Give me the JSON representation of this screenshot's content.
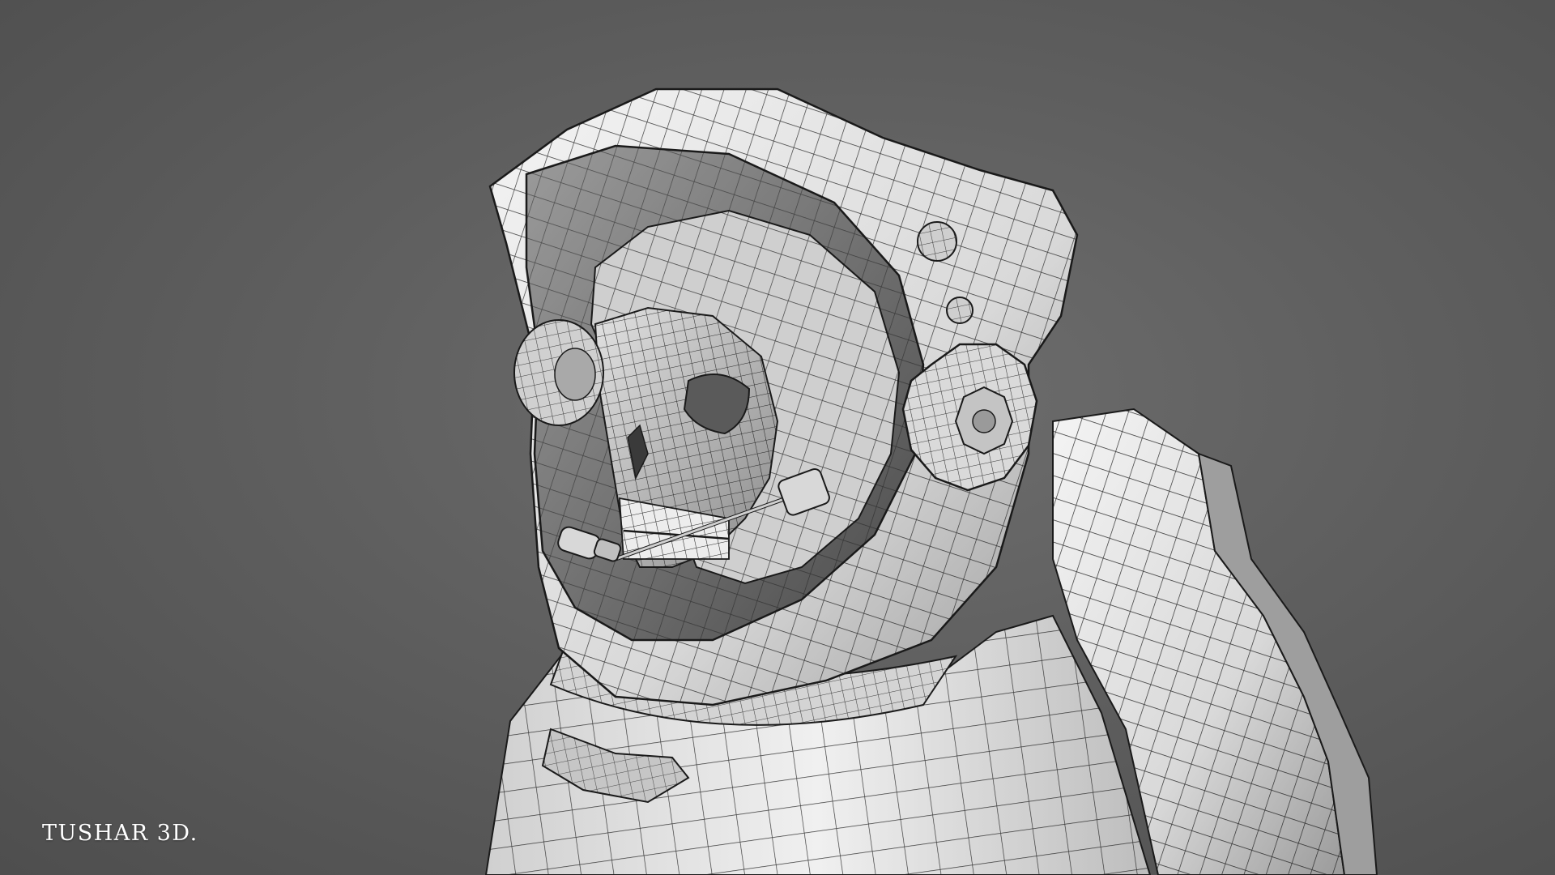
{
  "scene": {
    "subject": "astronaut-skull-wireframe-model",
    "background_color": "#616161",
    "shell_color": "#e6e6e6",
    "wire_color": "#1a1a1a"
  },
  "watermark": {
    "text": "TUSHAR 3D."
  }
}
